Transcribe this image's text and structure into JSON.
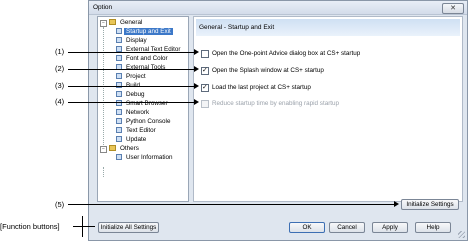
{
  "window": {
    "title": "Option",
    "close_icon": "close-icon"
  },
  "tree": {
    "items": [
      {
        "label": "General",
        "icon": "folder-icon",
        "expander": "−"
      },
      {
        "label": "Startup and Exit",
        "icon": "page-icon",
        "selected": true
      },
      {
        "label": "Display",
        "icon": "page-icon"
      },
      {
        "label": "External Text Editor",
        "icon": "page-icon"
      },
      {
        "label": "Font and Color",
        "icon": "page-icon"
      },
      {
        "label": "External Tools",
        "icon": "page-icon"
      },
      {
        "label": "Project",
        "icon": "page-icon"
      },
      {
        "label": "Build",
        "icon": "page-icon"
      },
      {
        "label": "Debug",
        "icon": "page-icon"
      },
      {
        "label": "Smart Browser",
        "icon": "page-icon"
      },
      {
        "label": "Network",
        "icon": "page-icon"
      },
      {
        "label": "Python Console",
        "icon": "page-icon"
      },
      {
        "label": "Text Editor",
        "icon": "page-icon"
      },
      {
        "label": "Update",
        "icon": "page-icon"
      },
      {
        "label": "Others",
        "icon": "folder-icon",
        "expander": "−"
      },
      {
        "label": "User Information",
        "icon": "page-icon"
      }
    ]
  },
  "panel": {
    "title": "General - Startup and Exit",
    "options": [
      {
        "label": "Open the One-point Advice dialog box at CS+ startup",
        "checked": false,
        "disabled": false
      },
      {
        "label": "Open the Splash window at CS+ startup",
        "checked": true,
        "disabled": false
      },
      {
        "label": "Load the last project at CS+ startup",
        "checked": true,
        "disabled": false
      },
      {
        "label": "Reduce startup time by enabling rapid startup",
        "checked": false,
        "disabled": true
      }
    ],
    "initialize_settings": "Initialize Settings"
  },
  "footer": {
    "initialize_all": "Initialize All Settings",
    "ok": "OK",
    "cancel": "Cancel",
    "apply": "Apply",
    "help": "Help"
  },
  "callouts": {
    "c1": "(1)",
    "c2": "(2)",
    "c3": "(3)",
    "c4": "(4)",
    "c5": "(5)",
    "function_buttons": "[Function buttons]"
  }
}
